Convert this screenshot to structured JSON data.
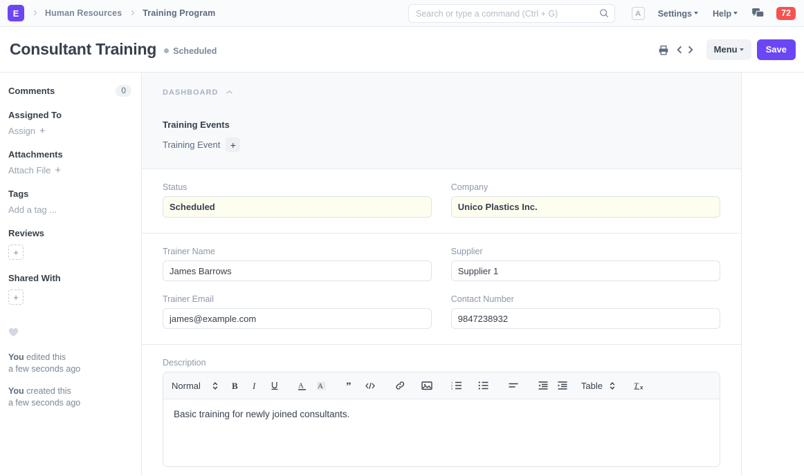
{
  "navbar": {
    "logo_letter": "E",
    "breadcrumbs": [
      {
        "label": "Human Resources"
      },
      {
        "label": "Training Program"
      }
    ],
    "search": {
      "placeholder": "Search or type a command (Ctrl + G)",
      "value": ""
    },
    "avatar_letter": "A",
    "settings_label": "Settings",
    "help_label": "Help",
    "notification_count": "72"
  },
  "page_header": {
    "title": "Consultant Training",
    "status": "Scheduled",
    "status_dot_color": "#a9b3c0",
    "menu_label": "Menu",
    "save_label": "Save",
    "save_color": "#6b46f5"
  },
  "sidebar": {
    "comments_label": "Comments",
    "comments_count": "0",
    "assigned_to_label": "Assigned To",
    "assign_label": "Assign",
    "attachments_label": "Attachments",
    "attach_file_label": "Attach File",
    "tags_label": "Tags",
    "add_tag_label": "Add a tag ...",
    "reviews_label": "Reviews",
    "reviews_add": "+",
    "shared_with_label": "Shared With",
    "shared_add": "+",
    "activity": [
      {
        "who": "You",
        "action": " edited this",
        "time": "a few seconds ago"
      },
      {
        "who": "You",
        "action": " created this",
        "time": "a few seconds ago"
      }
    ]
  },
  "dashboard": {
    "section_label": "DASHBOARD",
    "group_title": "Training Events",
    "link_label": "Training Event",
    "add_symbol": "+"
  },
  "form": {
    "status": {
      "label": "Status",
      "value": "Scheduled"
    },
    "company": {
      "label": "Company",
      "value": "Unico Plastics Inc."
    },
    "trainer_name": {
      "label": "Trainer Name",
      "value": "James Barrows"
    },
    "supplier": {
      "label": "Supplier",
      "value": "Supplier 1"
    },
    "trainer_email": {
      "label": "Trainer Email",
      "value": "james@example.com"
    },
    "contact_number": {
      "label": "Contact Number",
      "value": "9847238932"
    }
  },
  "description": {
    "label": "Description",
    "style_select": "Normal",
    "table_select": "Table",
    "content": "Basic training for newly joined consultants."
  }
}
